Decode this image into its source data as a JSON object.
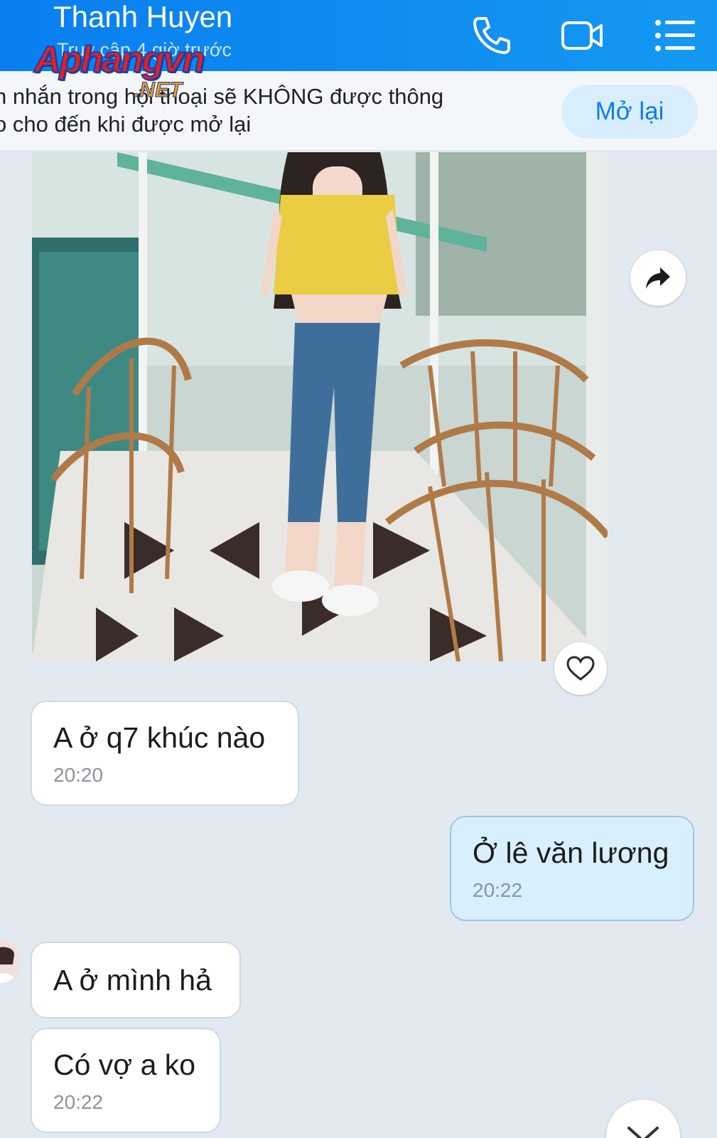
{
  "header": {
    "contact_name": "Thanh Huyen",
    "last_seen": "Truy cập 4 giờ trước",
    "icons": [
      "phone-icon",
      "video-call-icon",
      "menu-icon"
    ],
    "color": "#0A7EF0"
  },
  "watermark": {
    "main": "Aphangvn",
    "sub": ".NET"
  },
  "mute_banner": {
    "line1": "n nhắn trong hội thoại sẽ KHÔNG được thông",
    "line2": "o cho đến khi được mở lại",
    "button_label": "Mở lại"
  },
  "messages": [
    {
      "sender": "contact",
      "type": "image"
    },
    {
      "sender": "contact",
      "text": "A ở q7 khúc nào",
      "time": "20:20"
    },
    {
      "sender": "me",
      "text": "Ở lê văn lương",
      "time": "20:22"
    },
    {
      "sender": "contact",
      "text": "A ở mình hả"
    },
    {
      "sender": "contact",
      "text": "Có vợ a ko",
      "time": "20:22"
    }
  ],
  "colors": {
    "accent": "#0A7EF0",
    "chat_bg": "#E2E9F1",
    "my_bubble": "#D7EFFF"
  }
}
